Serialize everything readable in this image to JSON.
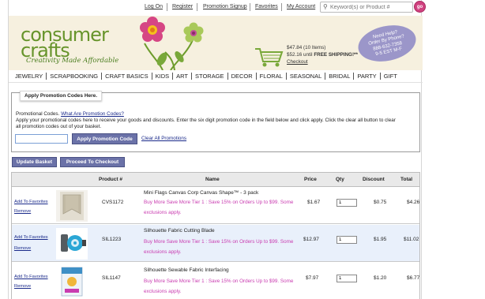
{
  "topbar": {
    "links": [
      "Log On",
      "Register",
      "Promotion Signup",
      "Favorites",
      "My Account"
    ],
    "search_placeholder": "Keyword(s) or Product #",
    "go_label": "go"
  },
  "header": {
    "logo_text": "consumer\ncrafts",
    "tagline": "Creativity Made Affordable",
    "cart": {
      "total_line": "$47.84 (10 Items)",
      "shipping_amount": "$52.16 until ",
      "shipping_free": "FREE SHIPPING!**",
      "checkout": "Checkout"
    },
    "help_badge": [
      "Need Help?",
      "Order By Phone?",
      "888-632-7358",
      "9-5 EST M-F"
    ]
  },
  "categories": [
    "JEWELRY",
    "SCRAPBOOKING",
    "CRAFT BASICS",
    "KIDS",
    "ART",
    "STORAGE",
    "DECOR",
    "FLORAL",
    "SEASONAL",
    "BRIDAL",
    "PARTY",
    "GIFT"
  ],
  "promo": {
    "tab_title": "Apply Promotion Codes Here.",
    "line1_prefix": "Promotional Codes. ",
    "line1_link": "What Are Promotion Codes?",
    "line2": "Apply your promotional codes here to receive your goods and discounts. Enter the six digit promotion code in the field below and click apply. Click the clear all button to clear",
    "line3": "all promotion codes out of your basket.",
    "input_value": "",
    "apply_label": "Apply Promotion Code",
    "clear_label": "Clear All Promotions"
  },
  "actions": {
    "update_label": "Update Basket",
    "checkout_label": "Proceed To Checkout"
  },
  "table": {
    "headers": {
      "product": "Product #",
      "name": "Name",
      "price": "Price",
      "qty": "Qty",
      "discount": "Discount",
      "total": "Total"
    },
    "favorites_label": "Add To Favorites",
    "remove_label": "Remove",
    "rows": [
      {
        "sku": "CVS1172",
        "name": "Mini Flags Canvas Corp Canvas Shape™ - 3 pack",
        "promo_message": "Buy More Save More Tier 1 : Save 15% on Orders Up to $99. Some exclusions apply.",
        "price": "$1.67",
        "qty": "1",
        "discount": "$0.75",
        "total": "$4.26",
        "thumb": "canvas-flags"
      },
      {
        "sku": "SIL1223",
        "name": "Silhouette Fabric Cutting Blade",
        "promo_message": "Buy More Save More Tier 1 : Save 15% on Orders Up to $99. Some exclusions apply.",
        "price": "$12.97",
        "qty": "1",
        "discount": "$1.95",
        "total": "$11.02",
        "thumb": "cutting-blade"
      },
      {
        "sku": "SIL1147",
        "name": "Silhouette Sewable Fabric Interfacing",
        "promo_message": "Buy More Save More Tier 1 : Save 15% on Orders Up to $99. Some exclusions apply.",
        "price": "$7.97",
        "qty": "1",
        "discount": "$1.20",
        "total": "$6.77",
        "thumb": "interfacing-pack"
      }
    ]
  },
  "colors": {
    "brand_green": "#67942b",
    "button_purple": "#6b72a8",
    "promo_pink": "#c93bb0",
    "row_alt": "#e9f0fb",
    "badge": "#9b96c9"
  }
}
